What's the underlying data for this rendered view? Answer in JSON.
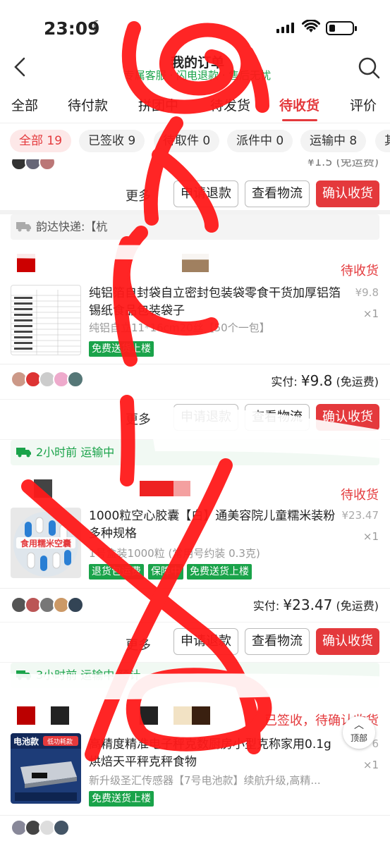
{
  "status_bar": {
    "time": "23:09"
  },
  "nav": {
    "title": "我的订单",
    "subtitle": "专属客服 · 闪电退款 · 售后无忧"
  },
  "tabs": [
    "全部",
    "待付款",
    "拼团中",
    "待发货",
    "待收货",
    "评价"
  ],
  "chips": [
    "全部 19",
    "已签收 9",
    "待取件 0",
    "派件中 0",
    "运输中 8",
    "其"
  ],
  "card0": {
    "paid_tail": "¥1.5 (免运费)"
  },
  "actions": {
    "more": "更多",
    "refund": "申请退款",
    "logistics": "查看物流",
    "confirm": "确认收货"
  },
  "order1": {
    "logistics": "韵达快递:【杭",
    "status": "待收货",
    "title": "纯铝箔自封袋自立密封包装袋零食干货加厚铝箔锡纸食品包装袋子",
    "spec": "纯铝自立11*16cm20丝【50个一包】",
    "tags": [
      "免费送货上楼"
    ],
    "price": "¥9.8",
    "qty": "×1",
    "paid_label": "实付:",
    "paid_amount": "¥9.8",
    "paid_note": "(免运费)"
  },
  "order2": {
    "logistics": "2小时前 运输中",
    "status": "待收货",
    "title": "1000粒空心胶囊【白】通美容院儿童糯米装粉多种规格",
    "thumb_label": "食用糯米空囊",
    "spec": "1号盒装1000粒 (常用号约装 0.3克)",
    "tags": [
      "退货包运费",
      "保障中",
      "免费送货上楼"
    ],
    "price": "¥23.47",
    "qty": "×1",
    "paid_label": "实付:",
    "paid_amount": "¥23.47",
    "paid_note": "(免运费)"
  },
  "order3": {
    "logistics": "3小时前 运输中 预计",
    "status": "已签收，待确认收货",
    "title": "高精度精准电子秤克数厨房小型克称家用0.1g烘焙天平秤克秤食物",
    "thumb_label": "电池款",
    "thumb_label2": "低功耗款",
    "spec": "新升级圣汇传感器【7号电池款】续航升级,高精...",
    "tags": [
      "免费送货上楼"
    ],
    "price": "6",
    "qty": "×1"
  },
  "top_button": "顶部",
  "colors": {
    "accent": "#e4393c",
    "green": "#1aa34a"
  }
}
